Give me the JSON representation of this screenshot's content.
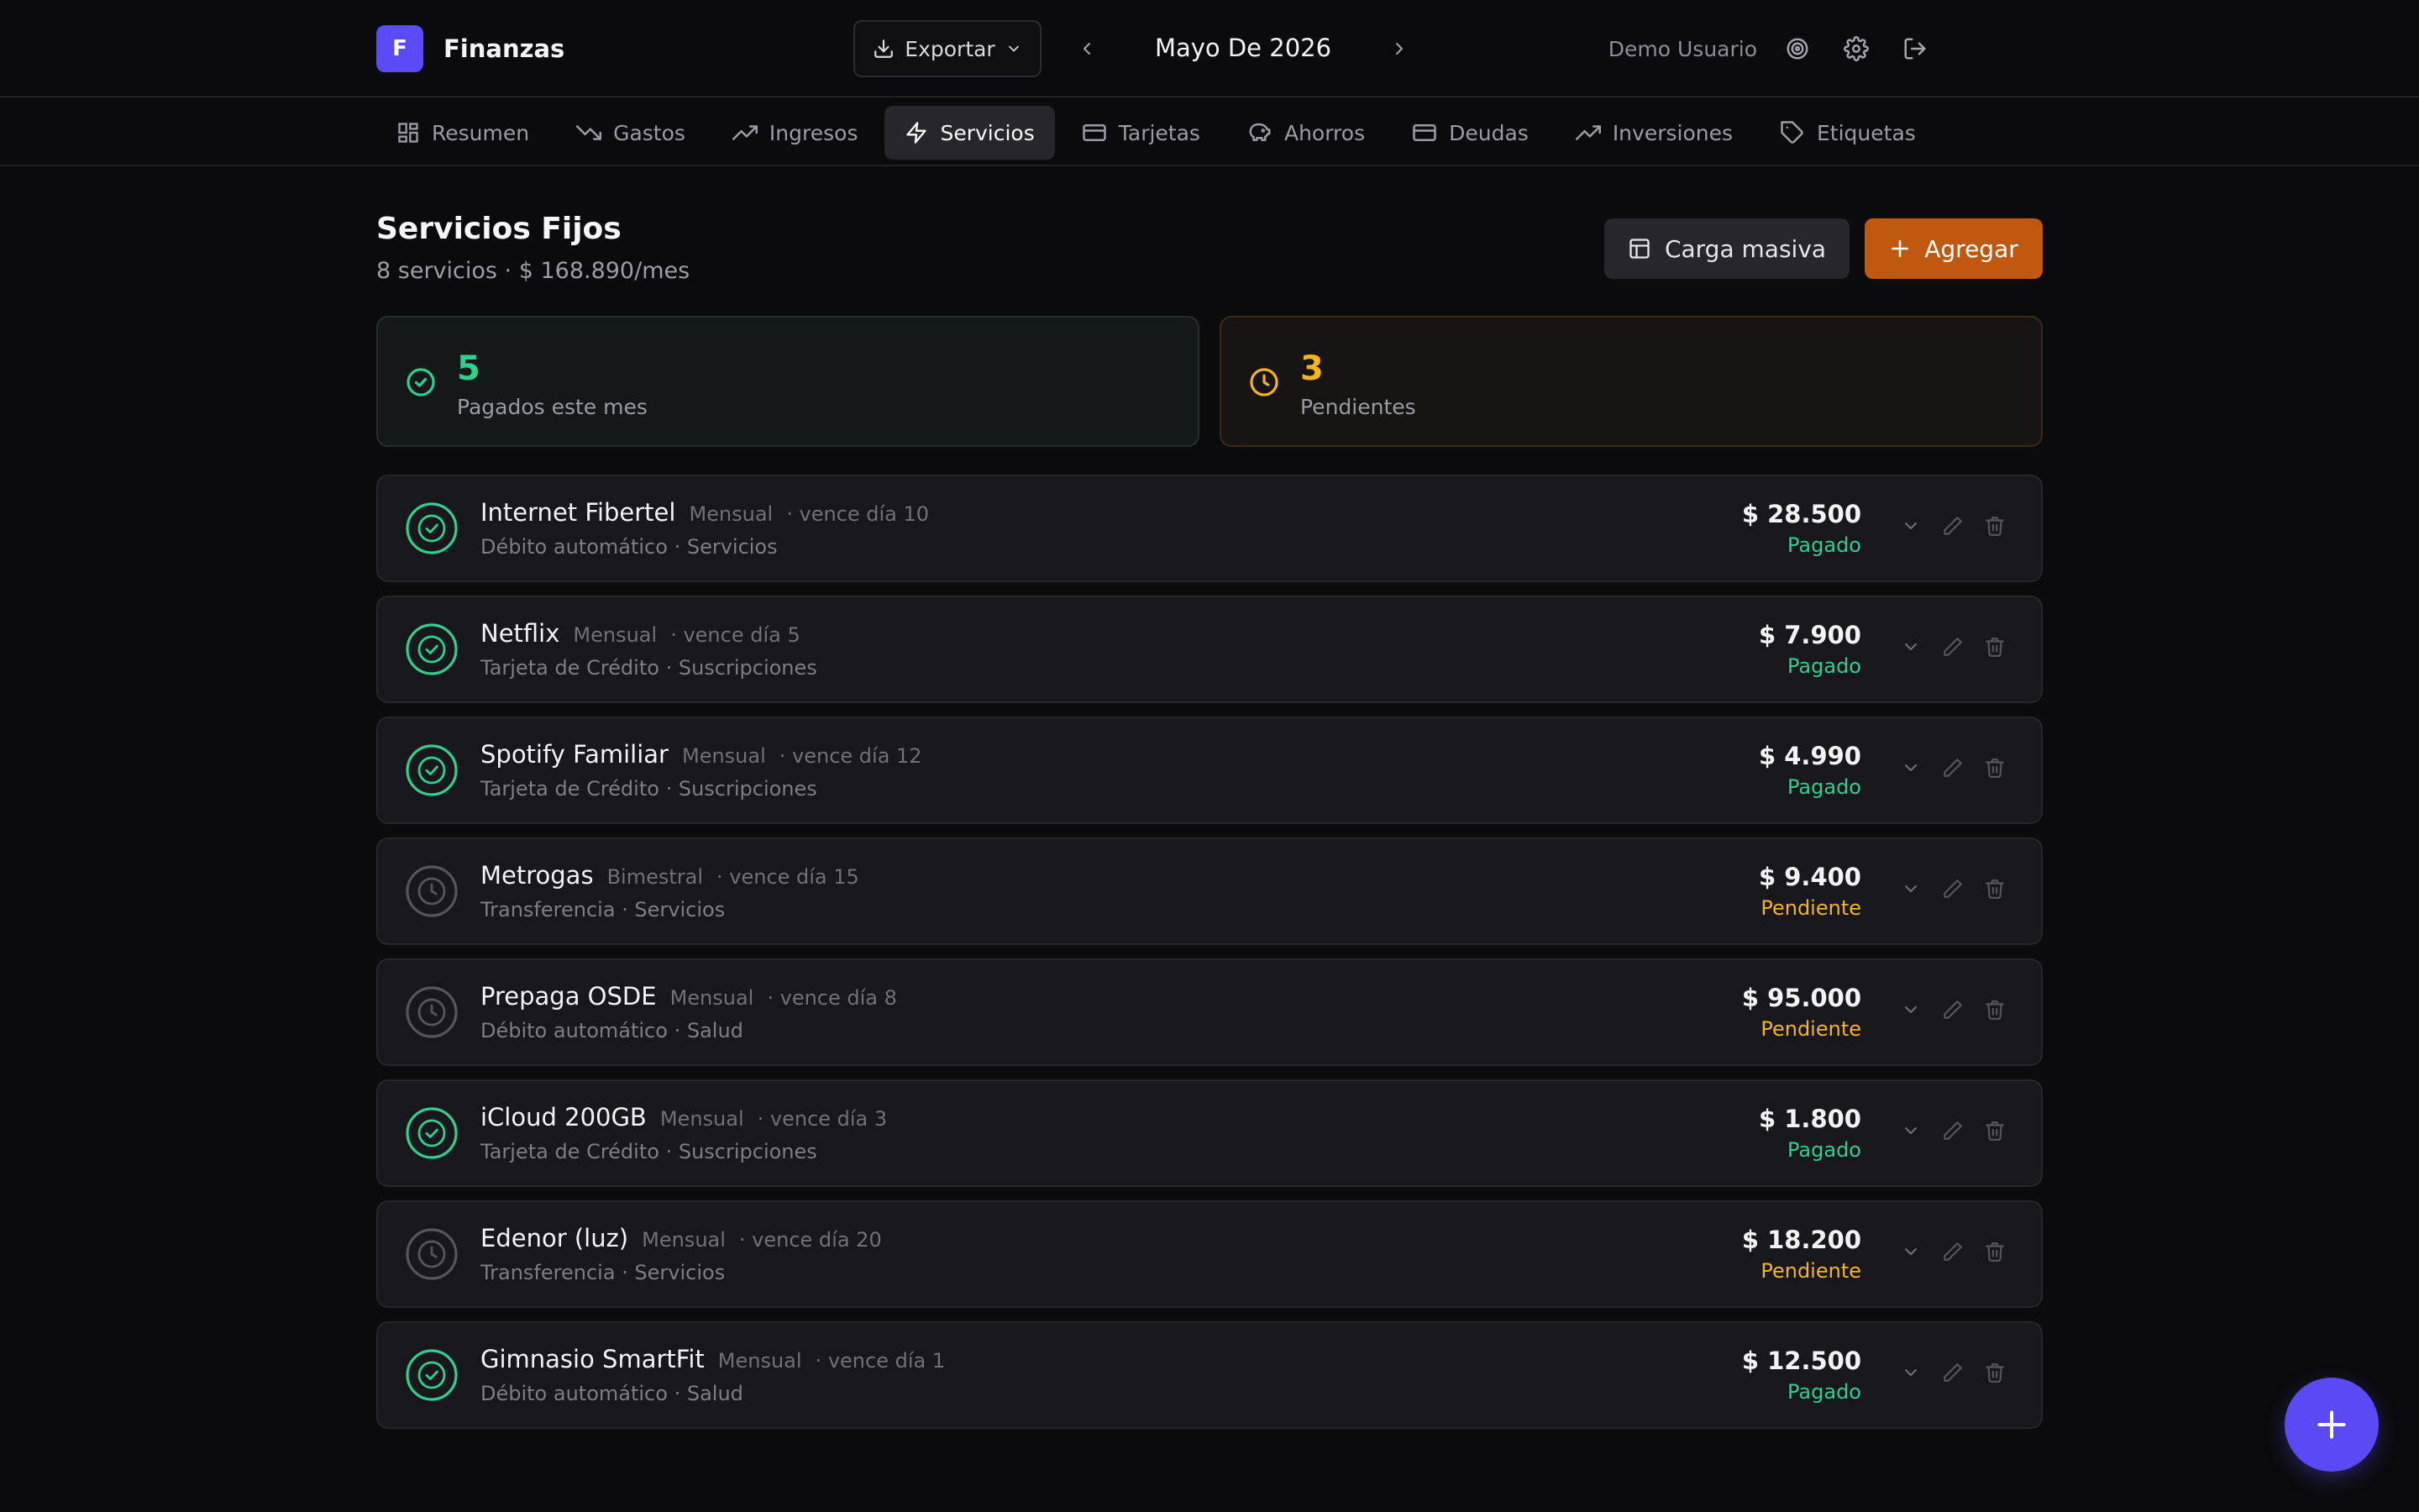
{
  "header": {
    "brand_initial": "F",
    "brand_name": "Finanzas",
    "export_label": "Exportar",
    "month_label": "Mayo De 2026",
    "user_name": "Demo Usuario"
  },
  "nav": {
    "tabs": [
      {
        "label": "Resumen",
        "icon": "grid-icon"
      },
      {
        "label": "Gastos",
        "icon": "trending-down-icon"
      },
      {
        "label": "Ingresos",
        "icon": "trending-up-icon"
      },
      {
        "label": "Servicios",
        "icon": "lightning-icon",
        "active": true
      },
      {
        "label": "Tarjetas",
        "icon": "credit-card-icon"
      },
      {
        "label": "Ahorros",
        "icon": "piggy-bank-icon"
      },
      {
        "label": "Deudas",
        "icon": "wallet-icon"
      },
      {
        "label": "Inversiones",
        "icon": "trending-up-icon"
      },
      {
        "label": "Etiquetas",
        "icon": "tag-icon"
      }
    ]
  },
  "page": {
    "title": "Servicios Fijos",
    "subtitle": "8 servicios · $ 168.890/mes",
    "bulk_label": "Carga masiva",
    "add_label": "Agregar"
  },
  "summary": {
    "paid_count": "5",
    "paid_label": "Pagados este mes",
    "pending_count": "3",
    "pending_label": "Pendientes"
  },
  "colors": {
    "accent": "#5b4bf5",
    "add_button": "#c1580f",
    "paid": "#2fcf8f",
    "pending": "#f5b41a"
  },
  "services": [
    {
      "name": "Internet Fibertel",
      "frequency": "Mensual",
      "due": "· vence día 10",
      "method": "Débito automático",
      "category": "Servicios",
      "amount": "$ 28.500",
      "status": "Pagado",
      "paid": true
    },
    {
      "name": "Netflix",
      "frequency": "Mensual",
      "due": "· vence día 5",
      "method": "Tarjeta de Crédito",
      "category": "Suscripciones",
      "amount": "$ 7.900",
      "status": "Pagado",
      "paid": true
    },
    {
      "name": "Spotify Familiar",
      "frequency": "Mensual",
      "due": "· vence día 12",
      "method": "Tarjeta de Crédito",
      "category": "Suscripciones",
      "amount": "$ 4.990",
      "status": "Pagado",
      "paid": true
    },
    {
      "name": "Metrogas",
      "frequency": "Bimestral",
      "due": "· vence día 15",
      "method": "Transferencia",
      "category": "Servicios",
      "amount": "$ 9.400",
      "status": "Pendiente",
      "paid": false
    },
    {
      "name": "Prepaga OSDE",
      "frequency": "Mensual",
      "due": "· vence día 8",
      "method": "Débito automático",
      "category": "Salud",
      "amount": "$ 95.000",
      "status": "Pendiente",
      "paid": false
    },
    {
      "name": "iCloud 200GB",
      "frequency": "Mensual",
      "due": "· vence día 3",
      "method": "Tarjeta de Crédito",
      "category": "Suscripciones",
      "amount": "$ 1.800",
      "status": "Pagado",
      "paid": true
    },
    {
      "name": "Edenor (luz)",
      "frequency": "Mensual",
      "due": "· vence día 20",
      "method": "Transferencia",
      "category": "Servicios",
      "amount": "$ 18.200",
      "status": "Pendiente",
      "paid": false
    },
    {
      "name": "Gimnasio SmartFit",
      "frequency": "Mensual",
      "due": "· vence día 1",
      "method": "Débito automático",
      "category": "Salud",
      "amount": "$ 12.500",
      "status": "Pagado",
      "paid": true
    }
  ]
}
